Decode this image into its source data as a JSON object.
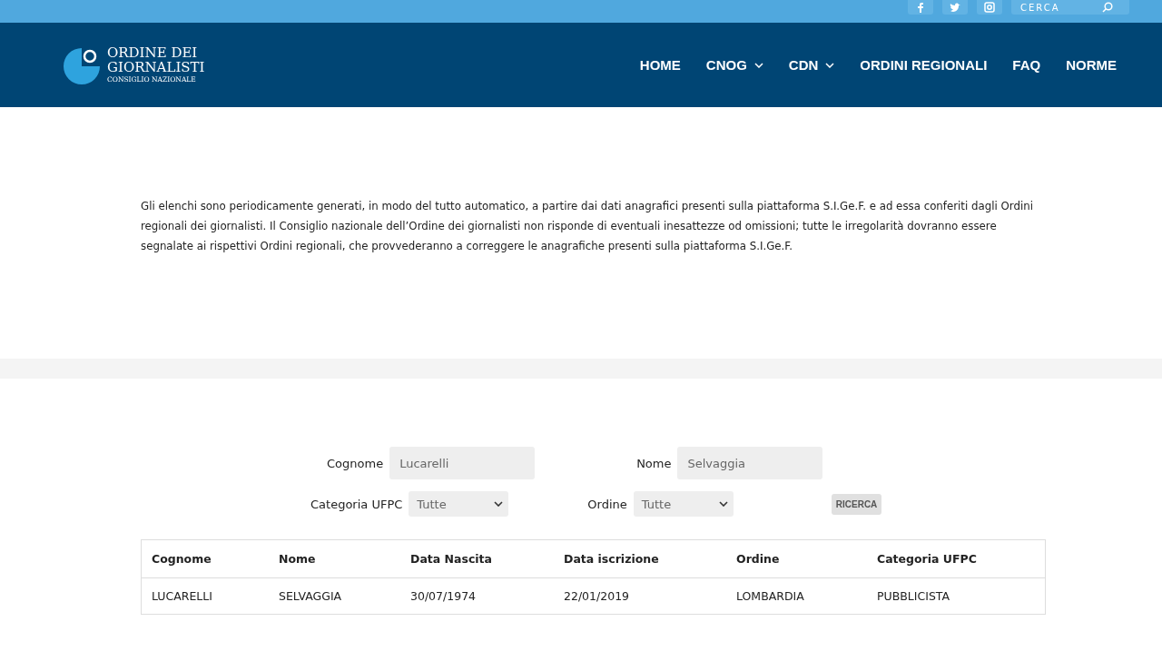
{
  "top_bar": {
    "search": {
      "placeholder": "CERCA"
    }
  },
  "logo": {
    "line_1": "ORDINE DEI",
    "line_2": "GIORNALISTI",
    "line_3": "CONSIGLIO NAZIONALE"
  },
  "nav": [
    {
      "label": "HOME",
      "dropdown": false
    },
    {
      "label": "CNOG",
      "dropdown": true
    },
    {
      "label": "CDN",
      "dropdown": true
    },
    {
      "label": "ORDINI REGIONALI",
      "dropdown": false
    },
    {
      "label": "FAQ",
      "dropdown": false
    },
    {
      "label": "NORME",
      "dropdown": false
    }
  ],
  "notice": "Gli elenchi sono periodicamente generati, in modo del tutto automatico, a partire dai dati anagrafici presenti sulla piattaforma S.I.Ge.F. e ad essa conferiti dagli Ordini regionali dei giornalisti. Il Consiglio nazionale dell’Ordine dei giornalisti non risponde di eventuali inesattezze od omissioni; tutte le irregolarità dovranno essere segnalate ai rispettivi Ordini regionali, che provvederanno a correggere le anagrafiche presenti sulla piattaforma S.I.Ge.F.",
  "form": {
    "cognome": {
      "label": "Cognome",
      "value": "Lucarelli"
    },
    "nome": {
      "label": "Nome",
      "value": "Selvaggia"
    },
    "categoria": {
      "label": "Categoria UFPC",
      "value": "Tutte"
    },
    "ordine": {
      "label": "Ordine",
      "value": "Tutte"
    },
    "button": "RICERCA"
  },
  "table": {
    "columns": [
      "Cognome",
      "Nome",
      "Data Nascita",
      "Data iscrizione",
      "Ordine",
      "Categoria UFPC"
    ],
    "rows": [
      [
        "LUCARELLI",
        "SELVAGGIA",
        "30/07/1974",
        "22/01/2019",
        "LOMBARDIA",
        "PUBBLICISTA"
      ]
    ]
  }
}
